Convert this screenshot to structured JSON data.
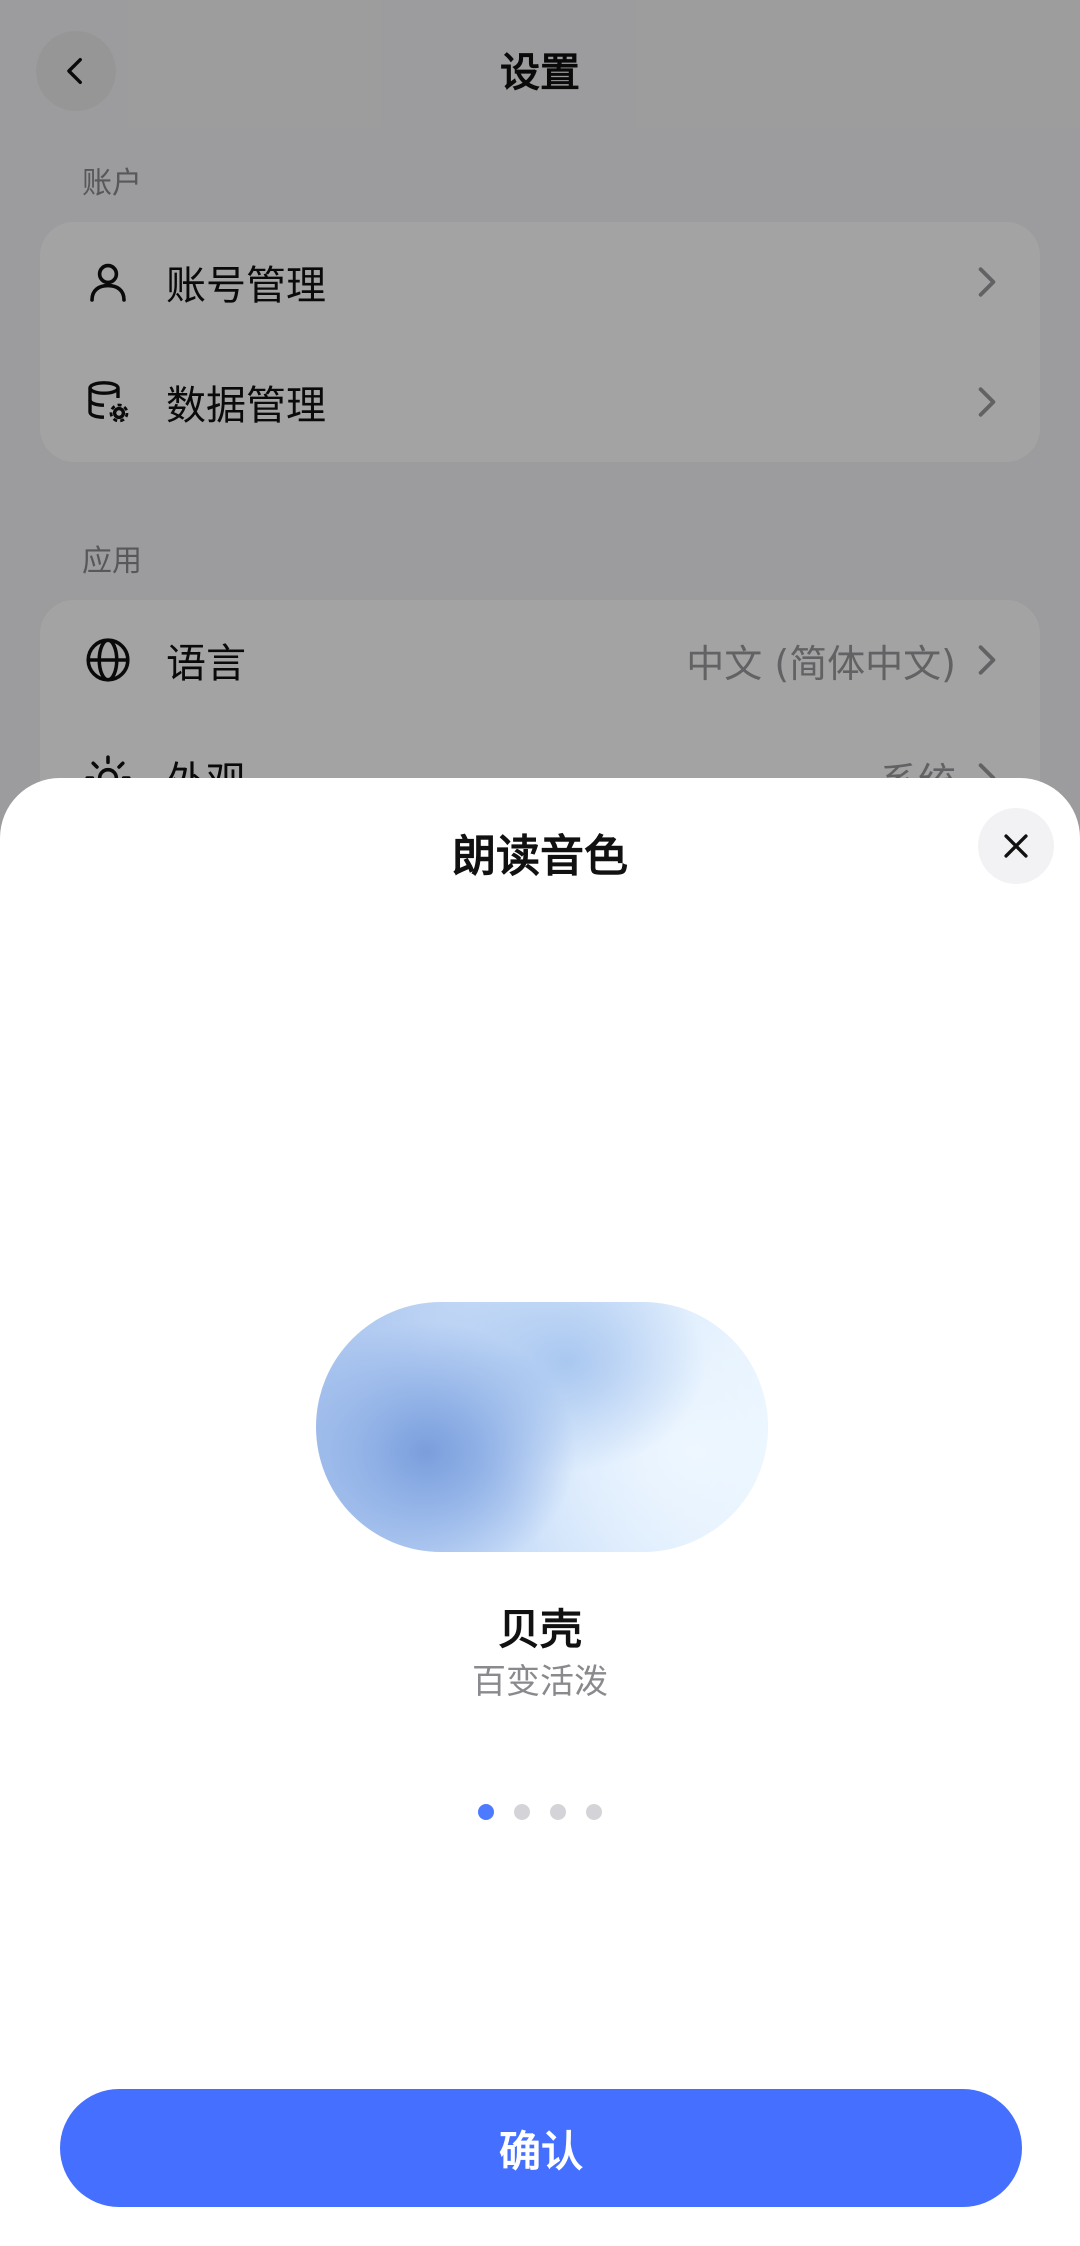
{
  "settings_page": {
    "title": "设置",
    "sections": [
      {
        "label": "账户",
        "items": [
          {
            "label": "账号管理",
            "icon": "person-icon"
          },
          {
            "label": "数据管理",
            "icon": "database-gear-icon"
          }
        ]
      },
      {
        "label": "应用",
        "items": [
          {
            "label": "语言",
            "value": "中文 (简体中文)",
            "icon": "globe-icon"
          },
          {
            "label": "外观",
            "value": "系统",
            "icon": "sun-icon"
          }
        ]
      }
    ]
  },
  "sheet": {
    "title": "朗读音色",
    "voice": {
      "name": "贝壳",
      "description": "百变活泼"
    },
    "pagination": {
      "total": 4,
      "current": 1
    },
    "confirm_label": "确认"
  },
  "colors": {
    "accent": "#4570ff",
    "dot_active": "#4d7bff",
    "dot_inactive": "#d4d4d8"
  }
}
